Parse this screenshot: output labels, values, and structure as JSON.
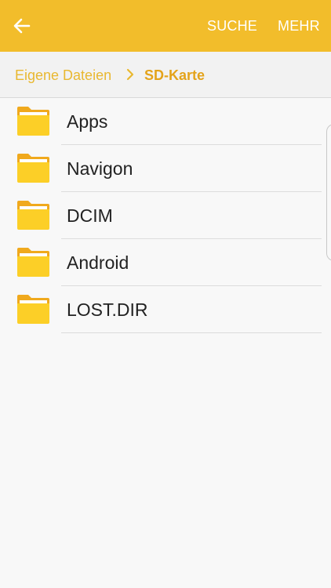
{
  "appbar": {
    "back_icon": "arrow-left-icon",
    "search_label": "SUCHE",
    "more_label": "MEHR",
    "color": "#f2bd2b"
  },
  "breadcrumb": {
    "home_label": "Eigene Dateien",
    "separator_icon": "chevron-right-icon",
    "current_label": "SD-Karte"
  },
  "files": [
    {
      "name": "Apps",
      "icon": "folder-icon"
    },
    {
      "name": "Navigon",
      "icon": "folder-icon"
    },
    {
      "name": "DCIM",
      "icon": "folder-icon"
    },
    {
      "name": "Android",
      "icon": "folder-icon"
    },
    {
      "name": "LOST.DIR",
      "icon": "folder-icon"
    }
  ]
}
